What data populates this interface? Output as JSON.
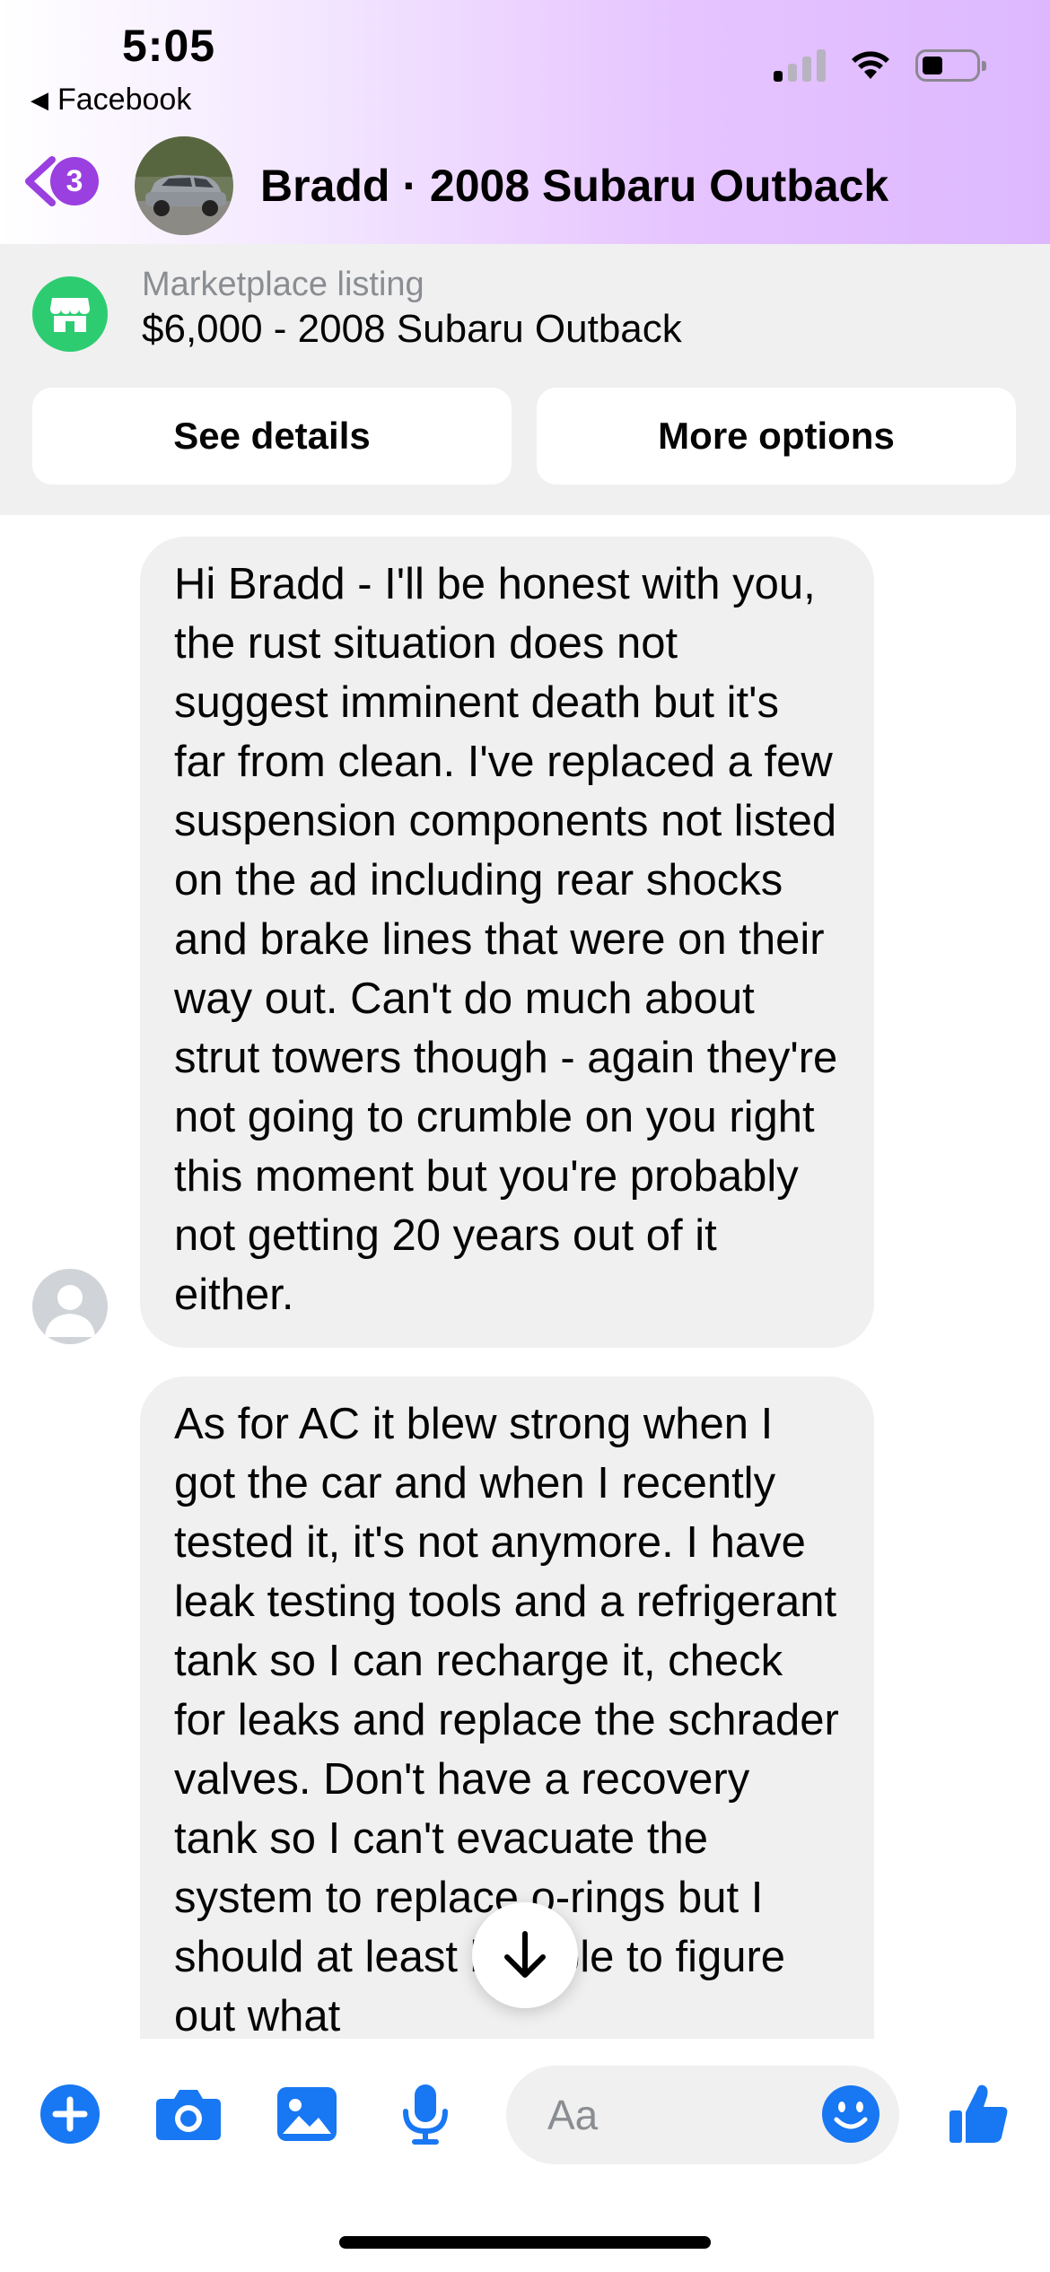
{
  "status_bar": {
    "time": "5:05",
    "back_app": "Facebook"
  },
  "header": {
    "unread_count": "3",
    "title": "Bradd · 2008 Subaru Outback",
    "accent": "#9a3fe0"
  },
  "listing": {
    "kicker": "Marketplace listing",
    "title": "$6,000 - 2008 Subaru Outback",
    "see_details": "See details",
    "more_options": "More options"
  },
  "messages": [
    {
      "text": "Hi Bradd - I'll be honest with you, the rust situation does not suggest imminent death but it's far from clean. I've replaced a few suspension components not listed on the ad including rear shocks and brake lines that were on their way out. Can't do much about strut towers though - again they're not going to crumble on you right this moment but you're probably not getting 20 years out of it either."
    },
    {
      "text": "As for AC it blew strong when I got the car and when I recently tested it, it's not anymore. I have leak testing tools and a refrigerant tank so I can recharge it, check for leaks and replace the schrader valves. Don't have a recovery tank so I can't evacuate the system to replace o-rings but I should at least be able to figure out what"
    }
  ],
  "composer": {
    "placeholder": "Aa",
    "icons": [
      "plus-icon",
      "camera-icon",
      "image-icon",
      "microphone-icon",
      "emoji-icon",
      "thumbs-up-icon"
    ],
    "icon_color": "#1877f2"
  }
}
